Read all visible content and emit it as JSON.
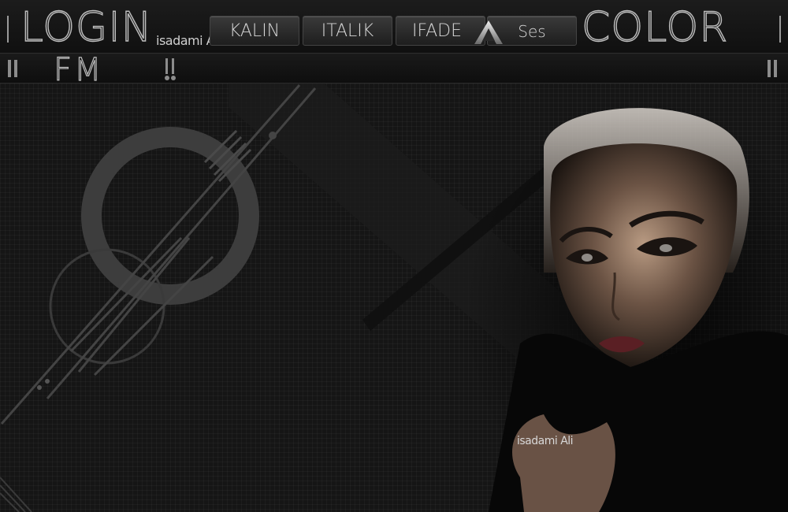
{
  "header": {
    "login_label": "LOGIN",
    "login_sub": "isadami Ali",
    "color_label": "COLOR"
  },
  "toolbar": {
    "bold_label": "KALIN",
    "italic_label": "ITALIK",
    "emote_label": "IFADE",
    "sound_label": "Ses",
    "font_icon": "letter-a-icon"
  },
  "radio": {
    "fm_label": "FM"
  },
  "stage": {
    "signature": "isadami Ali"
  },
  "colors": {
    "background": "#151515",
    "outline": "#bdbdbd",
    "button": "#2c2c2c"
  }
}
